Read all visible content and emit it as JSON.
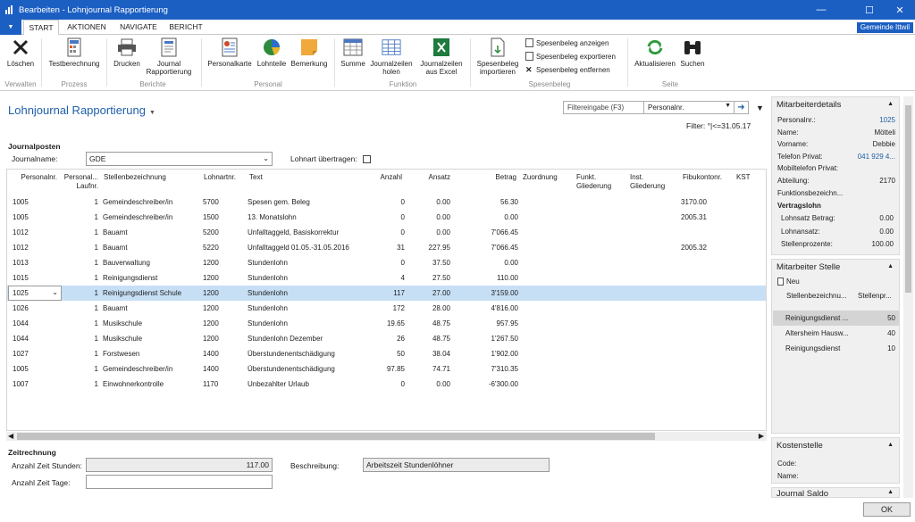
{
  "window": {
    "title": "Bearbeiten - Lohnjournal Rapportierung",
    "min_glyph": "—",
    "max_glyph": "☐",
    "close_glyph": "✕"
  },
  "tabs": [
    "START",
    "AKTIONEN",
    "NAVIGATE",
    "BERICHT"
  ],
  "app_menu_glyph": "▼",
  "company": "Gemeinde Ittwil",
  "ribbon": {
    "buttons": [
      "Löschen",
      "Testberechnung",
      "Drucken",
      "Journal Rapportierung",
      "Personalkarte",
      "Lohnteile",
      "Bemerkung",
      "Summe",
      "Journalzeilen holen",
      "Journalzeilen aus Excel",
      "Spesenbeleg importieren",
      "Aktualisieren",
      "Suchen"
    ],
    "small": [
      "Spesenbeleg anzeigen",
      "Spesenbeleg exportieren",
      "Spesenbeleg entfernen"
    ],
    "groups": [
      "Verwalten",
      "Prozess",
      "Berichte",
      "Personal",
      "Funktion",
      "Spesenbeleg",
      "Seite"
    ]
  },
  "page_title": "Lohnjournal Rapportierung",
  "filter": {
    "label": "Filtereingabe (F3)",
    "field": "Personalnr.",
    "text": "Filter: °|<=31.05.17"
  },
  "journal": {
    "section": "Journalposten",
    "name_label": "Journalname:",
    "name_value": "GDE",
    "lohnart_label": "Lohnart übertragen:"
  },
  "grid": {
    "headers": [
      "Personalnr.",
      "Personal... Laufnr.",
      "Stellenbezeichnung",
      "Lohnartnr.",
      "Text",
      "Anzahl",
      "Ansatz",
      "Betrag",
      "Zuordnung",
      "Funkt. Gliederung",
      "Inst. Gliederung",
      "Fibukontonr.",
      "KST"
    ],
    "rows": [
      [
        "1005",
        "1",
        "Gemeindeschreiber/in",
        "5700",
        "Spesen gem. Beleg",
        "0",
        "0.00",
        "56.30",
        "3170.00"
      ],
      [
        "1005",
        "1",
        "Gemeindeschreiber/in",
        "1500",
        "13. Monatslohn",
        "0",
        "0.00",
        "0.00",
        "2005.31"
      ],
      [
        "1012",
        "1",
        "Bauamt",
        "5200",
        "Unfalltaggeld, Basiskorrektur",
        "0",
        "0.00",
        "7'066.45",
        ""
      ],
      [
        "1012",
        "1",
        "Bauamt",
        "5220",
        "Unfalltaggeld 01.05.-31.05.2016",
        "31",
        "227.95",
        "7'066.45",
        "2005.32"
      ],
      [
        "1013",
        "1",
        "Bauverwaltung",
        "1200",
        "Stundenlohn",
        "0",
        "37.50",
        "0.00",
        ""
      ],
      [
        "1015",
        "1",
        "Reinigungsdienst",
        "1200",
        "Stundenlohn",
        "4",
        "27.50",
        "110.00",
        ""
      ],
      [
        "1025",
        "1",
        "Reinigungsdienst Schule",
        "1200",
        "Stundenlohn",
        "117",
        "27.00",
        "3'159.00",
        ""
      ],
      [
        "1026",
        "1",
        "Bauamt",
        "1200",
        "Stundenlohn",
        "172",
        "28.00",
        "4'816.00",
        ""
      ],
      [
        "1044",
        "1",
        "Musikschule",
        "1200",
        "Stundenlohn",
        "19.65",
        "48.75",
        "957.95",
        ""
      ],
      [
        "1044",
        "1",
        "Musikschule",
        "1200",
        "Stundenlohn Dezember",
        "26",
        "48.75",
        "1'267.50",
        ""
      ],
      [
        "1027",
        "1",
        "Forstwesen",
        "1400",
        "Überstundenentschädigung",
        "50",
        "38.04",
        "1'902.00",
        ""
      ],
      [
        "1005",
        "1",
        "Gemeindeschreiber/in",
        "1400",
        "Überstundenentschädigung",
        "97.85",
        "74.71",
        "7'310.35",
        ""
      ],
      [
        "1007",
        "1",
        "Einwohnerkontrolle",
        "1170",
        "Unbezahlter Urlaub",
        "0",
        "0.00",
        "-6'300.00",
        ""
      ]
    ],
    "selected_row": 6
  },
  "zeitrechnung": {
    "section": "Zeitrechnung",
    "stunden_label": "Anzahl Zeit Stunden:",
    "stunden_value": "117.00",
    "tage_label": "Anzahl Zeit Tage:",
    "beschreibung_label": "Beschreibung:",
    "beschreibung_value": "Arbeitszeit Stundenlöhner"
  },
  "mitarbeiterdetails": {
    "title": "Mitarbeiterdetails",
    "fields": [
      {
        "label": "Personalnr.:",
        "value": "1025",
        "link": true
      },
      {
        "label": "Name:",
        "value": "Mötteli",
        "link": false
      },
      {
        "label": "Vorname:",
        "value": "Debbie",
        "link": false
      },
      {
        "label": "Telefon Privat:",
        "value": "041 929 4...",
        "link": true
      },
      {
        "label": "Mobiltelefon Privat:",
        "value": "",
        "link": false
      },
      {
        "label": "Abteilung:",
        "value": "2170",
        "link": false
      },
      {
        "label": "Funktionsbezeichn...",
        "value": "",
        "link": false
      }
    ],
    "vertragslohn": "Vertragslohn",
    "vfields": [
      {
        "label": "Lohnsatz Betrag:",
        "value": "0.00"
      },
      {
        "label": "Lohnansatz:",
        "value": "0.00"
      },
      {
        "label": "Stellenprozente:",
        "value": "100.00"
      }
    ]
  },
  "mitarbeiterstelle": {
    "title": "Mitarbeiter Stelle",
    "new_label": "Neu",
    "headers": [
      "Stellenbezeichnu...",
      "Stellenpr..."
    ],
    "rows": [
      [
        "Reinigungsdienst ...",
        "50"
      ],
      [
        "Altersheim Hausw...",
        "40"
      ],
      [
        "Reinigungsdienst",
        "10"
      ]
    ]
  },
  "kostenstelle": {
    "title": "Kostenstelle",
    "code_label": "Code:",
    "name_label": "Name:"
  },
  "journalsaldo": {
    "title": "Journal Saldo"
  },
  "ok_label": "OK",
  "glyphs": {
    "up": "▲",
    "down": "▼",
    "right": "➜",
    "left_arrow": "◀",
    "right_arrow": "▶",
    "caret": "▾",
    "chevron": "⌄",
    "collapse": "▼"
  }
}
